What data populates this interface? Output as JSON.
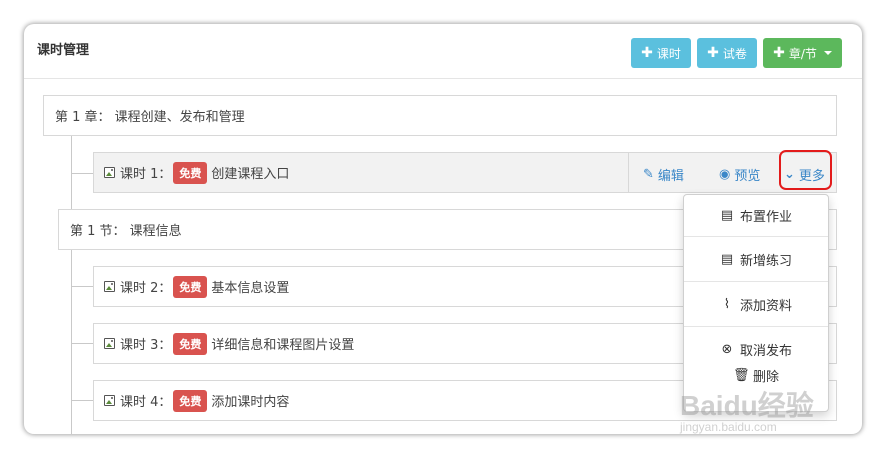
{
  "header": {
    "title": "课时管理",
    "buttons": [
      {
        "label": "课时",
        "icon": "plus-icon"
      },
      {
        "label": "试卷",
        "icon": "plus-icon"
      },
      {
        "label": "章/节",
        "icon": "plus-icon"
      }
    ]
  },
  "chapter": {
    "label": "第 1 章：  课程创建、发布和管理"
  },
  "section": {
    "label": "第 1 节：  课程信息"
  },
  "lessons": [
    {
      "label": "课时 1：",
      "badge": "免费",
      "title": "创建课程入口"
    },
    {
      "label": "课时 2：",
      "badge": "免费",
      "title": "基本信息设置"
    },
    {
      "label": "课时 3：",
      "badge": "免费",
      "title": "详细信息和课程图片设置"
    },
    {
      "label": "课时 4：",
      "badge": "免费",
      "title": "添加课时内容"
    }
  ],
  "lesson_actions": {
    "edit": "编辑",
    "preview": "预览",
    "more": "更多"
  },
  "dropdown": {
    "items": [
      {
        "label": "布置作业",
        "icon": "list-icon"
      },
      {
        "label": "新增练习",
        "icon": "list-icon"
      },
      {
        "label": "添加资料",
        "icon": "paperclip-icon"
      },
      {
        "label": "取消发布",
        "icon": "cancel-circle-icon"
      },
      {
        "label": "删除",
        "icon": "trash-icon"
      }
    ]
  },
  "watermark": {
    "text": "Baidu经验",
    "sub": "jingyan.baidu.com"
  },
  "colors": {
    "info": "#5bc0de",
    "success": "#5cb85c",
    "danger": "#d9534f",
    "link": "#3a87c8",
    "highlight": "#e31b1b"
  }
}
